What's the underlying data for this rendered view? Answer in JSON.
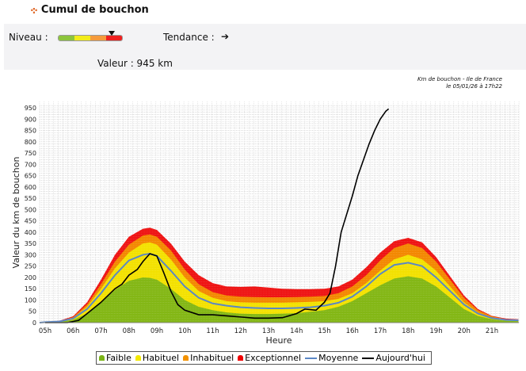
{
  "header": {
    "icon": "move-icon",
    "title": "Cumul de bouchon"
  },
  "panel": {
    "niveau_label": "Niveau :",
    "niveau_level": 0.88,
    "tendance_label": "Tendance :",
    "tendance_arrow": "➔",
    "valeur_label": "Valeur : 945 km"
  },
  "stamp": {
    "line1": "Km de bouchon - Ile de France",
    "line2": "le 05/01/26 à 17h22"
  },
  "colors": {
    "faible": "#7ab317",
    "habituel": "#f3e800",
    "inhabituel": "#f39200",
    "exceptionnel": "#ee0000",
    "moyenne": "#5b87c5",
    "aujourdhui": "#000000"
  },
  "chart_data": {
    "type": "area",
    "xlabel": "Heure",
    "ylabel": "Valeur du  km de bouchon",
    "xlim": [
      4.8,
      21.96
    ],
    "ylim": [
      0,
      950
    ],
    "xticks": [
      {
        "v": 5,
        "l": "05h"
      },
      {
        "v": 6,
        "l": "06h"
      },
      {
        "v": 7,
        "l": "07h"
      },
      {
        "v": 8,
        "l": "08h"
      },
      {
        "v": 9,
        "l": "09h"
      },
      {
        "v": 10,
        "l": "10h"
      },
      {
        "v": 11,
        "l": "11h"
      },
      {
        "v": 12,
        "l": "12h"
      },
      {
        "v": 13,
        "l": "13h"
      },
      {
        "v": 14,
        "l": "14h"
      },
      {
        "v": 15,
        "l": "15h"
      },
      {
        "v": 16,
        "l": "16h"
      },
      {
        "v": 17,
        "l": "17h"
      },
      {
        "v": 18,
        "l": "18h"
      },
      {
        "v": 19,
        "l": "19h"
      },
      {
        "v": 20,
        "l": "20h"
      },
      {
        "v": 21,
        "l": "21h"
      }
    ],
    "yticks": [
      "0",
      "50",
      "100",
      "150",
      "200",
      "250",
      "300",
      "350",
      "400",
      "450",
      "500",
      "550",
      "600",
      "650",
      "700",
      "750",
      "800",
      "850",
      "900",
      "950"
    ],
    "x": [
      4.8,
      5,
      5.5,
      6,
      6.5,
      7,
      7.5,
      8,
      8.5,
      8.75,
      9,
      9.5,
      10,
      10.5,
      11,
      11.5,
      12,
      12.5,
      13,
      13.5,
      14,
      14.5,
      15,
      15.5,
      16,
      16.5,
      17,
      17.5,
      18,
      18.5,
      19,
      19.5,
      20,
      20.5,
      21,
      21.5,
      21.95
    ],
    "series": [
      {
        "name": "Exceptionnel",
        "key": "exceptionnel",
        "values": [
          0,
          3,
          8,
          28,
          90,
          190,
          300,
          380,
          415,
          420,
          410,
          350,
          270,
          210,
          175,
          160,
          158,
          160,
          155,
          150,
          148,
          148,
          150,
          160,
          190,
          245,
          310,
          360,
          375,
          355,
          290,
          205,
          120,
          60,
          30,
          18,
          15
        ]
      },
      {
        "name": "Inhabituel",
        "key": "inhabituel",
        "values": [
          0,
          2,
          6,
          24,
          80,
          170,
          270,
          345,
          385,
          390,
          380,
          320,
          235,
          170,
          135,
          120,
          115,
          113,
          112,
          112,
          113,
          115,
          118,
          130,
          160,
          210,
          275,
          330,
          350,
          330,
          270,
          190,
          110,
          55,
          28,
          15,
          12
        ]
      },
      {
        "name": "Habituel",
        "key": "habituel",
        "values": [
          0,
          2,
          5,
          20,
          70,
          150,
          240,
          310,
          350,
          355,
          345,
          280,
          200,
          140,
          110,
          95,
          90,
          88,
          88,
          88,
          90,
          92,
          95,
          105,
          130,
          175,
          230,
          280,
          300,
          280,
          230,
          160,
          90,
          45,
          22,
          12,
          10
        ]
      },
      {
        "name": "Faible",
        "key": "faible",
        "values": [
          0,
          1,
          3,
          12,
          40,
          90,
          145,
          185,
          200,
          198,
          190,
          150,
          100,
          70,
          55,
          45,
          40,
          38,
          38,
          40,
          42,
          48,
          55,
          70,
          95,
          130,
          165,
          195,
          205,
          195,
          160,
          110,
          60,
          30,
          15,
          8,
          6
        ]
      },
      {
        "name": "Moyenne",
        "key": "moyenne",
        "line": true,
        "values": [
          0,
          2,
          5,
          18,
          60,
          130,
          210,
          275,
          300,
          305,
          295,
          230,
          160,
          110,
          85,
          75,
          68,
          65,
          63,
          63,
          65,
          68,
          75,
          88,
          115,
          160,
          215,
          255,
          265,
          250,
          200,
          140,
          80,
          40,
          20,
          12,
          10
        ]
      }
    ],
    "today": {
      "name": "Aujourd'hui",
      "x": [
        5,
        5.8,
        6.2,
        6.5,
        7,
        7.5,
        7.75,
        8,
        8.3,
        8.5,
        8.75,
        9,
        9.25,
        9.5,
        9.75,
        10,
        10.5,
        11,
        11.5,
        12,
        12.5,
        13,
        13.5,
        14,
        14.3,
        14.7,
        15,
        15.2,
        15.4,
        15.6,
        15.8,
        16,
        16.2,
        16.4,
        16.6,
        16.8,
        17,
        17.2,
        17.3
      ],
      "y": [
        0,
        0,
        10,
        40,
        90,
        150,
        170,
        210,
        235,
        270,
        305,
        295,
        220,
        140,
        80,
        55,
        35,
        35,
        30,
        25,
        20,
        20,
        22,
        40,
        60,
        55,
        90,
        130,
        250,
        400,
        480,
        560,
        650,
        720,
        790,
        850,
        900,
        935,
        945
      ]
    },
    "legend": [
      "Faible",
      "Habituel",
      "Inhabituel",
      "Exceptionnel",
      "Moyenne",
      "Aujourd'hui"
    ],
    "legend_position": "bottom"
  }
}
